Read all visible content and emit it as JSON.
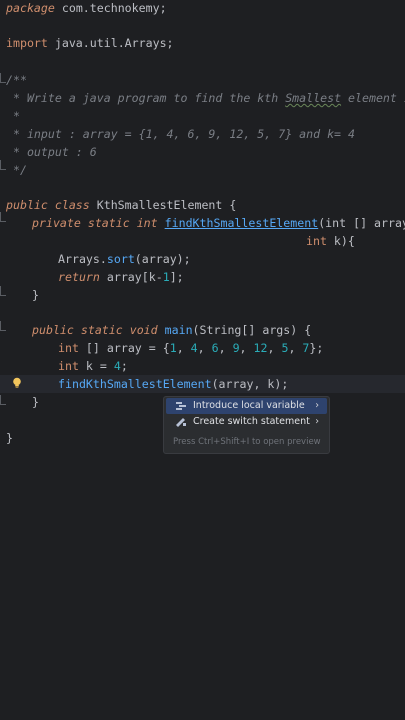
{
  "code": {
    "package_kw": "package",
    "package_name": " com.technokemy;",
    "import_kw": "import",
    "import_name": " java.util.Arrays;",
    "comment_open": "/**",
    "comment_line1_a": " * Write a java program to find the kth ",
    "comment_line1_b": "Smallest",
    "comment_line1_c": " element in a",
    "comment_star": " *",
    "comment_input": " * input : array = {1, 4, 6, 9, 12, 5, 7} and k= 4",
    "comment_output": " * output : 6",
    "comment_close": " */",
    "class_kw": "public class",
    "class_name": " KthSmallestElement {",
    "method1_kw": "private static int",
    "method1_name": "findKthSmallestElement",
    "method1_params_a": "(int [] array,",
    "method1_params_b_kw": "int",
    "method1_params_b": " k){",
    "sort_a": "Arrays.",
    "sort_fn": "sort",
    "sort_b": "(array);",
    "return_kw": "return",
    "return_expr_a": " array[k-",
    "return_expr_num": "1",
    "return_expr_b": "];",
    "close_brace": "}",
    "main_kw": "public static void",
    "main_name": "main",
    "main_params": "(String[] args) {",
    "array_decl_kw": "int",
    "array_decl_a": " [] array = {",
    "array_values": [
      {
        "v": "1",
        "s": ", "
      },
      {
        "v": "4",
        "s": ", "
      },
      {
        "v": "6",
        "s": ", "
      },
      {
        "v": "9",
        "s": ", "
      },
      {
        "v": "12",
        "s": ", "
      },
      {
        "v": "5",
        "s": ", "
      },
      {
        "v": "7",
        "s": ""
      }
    ],
    "array_decl_b": "};",
    "k_decl_kw": "int",
    "k_decl_a": " k = ",
    "k_decl_num": "4",
    "k_decl_b": ";",
    "call_fn": "findKthSmallestElement",
    "call_args": "(array, k);"
  },
  "intention_menu": {
    "items": [
      {
        "label": "Introduce local variable",
        "icon": "refactor-icon",
        "selected": true
      },
      {
        "label": "Create switch statement",
        "icon": "intention-icon",
        "selected": false
      }
    ],
    "hint": "Press Ctrl+Shift+I to open preview"
  },
  "colors": {
    "background": "#1e1f22",
    "keyword": "#cf8e6d",
    "comment": "#7a7e85",
    "function": "#56a8f5",
    "number": "#2aacb8",
    "menu_selected": "#2e436e"
  }
}
